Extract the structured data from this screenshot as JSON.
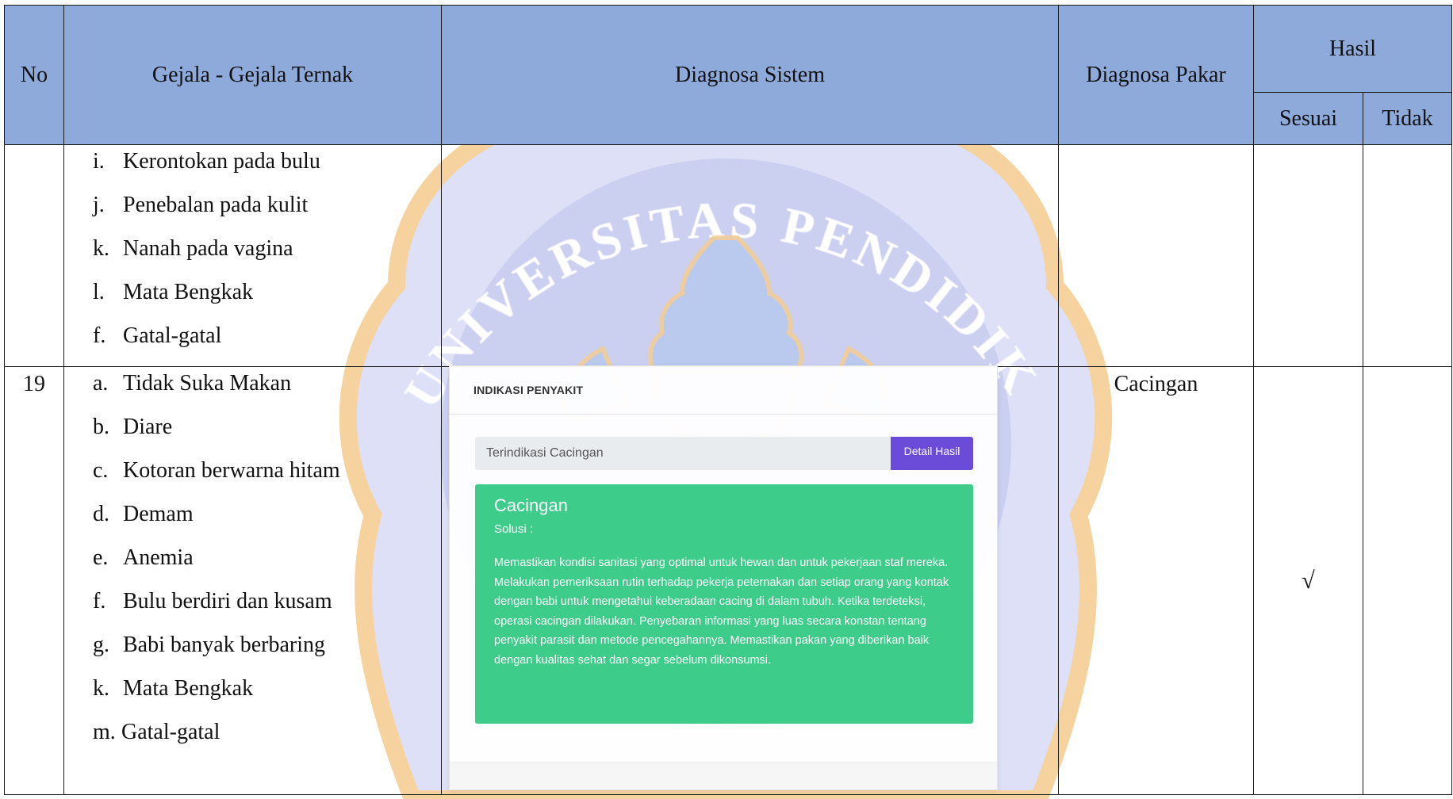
{
  "table": {
    "headers": {
      "no": "No",
      "gejala": "Gejala - Gejala Ternak",
      "diagnosa_sistem": "Diagnosa Sistem",
      "diagnosa_pakar": "Diagnosa Pakar",
      "hasil": "Hasil",
      "sesuai": "Sesuai",
      "tidak": "Tidak"
    },
    "row_continued": {
      "no": "",
      "symptoms": [
        {
          "letter": "i.",
          "text": "Kerontokan pada bulu"
        },
        {
          "letter": "j.",
          "text": "Penebalan pada kulit"
        },
        {
          "letter": "k.",
          "text": "Nanah pada vagina"
        },
        {
          "letter": "l.",
          "text": "Mata Bengkak"
        },
        {
          "letter": "f.",
          "text": "Gatal-gatal"
        }
      ]
    },
    "row_19": {
      "no": "19",
      "symptoms": [
        {
          "letter": "a.",
          "text": "Tidak Suka Makan"
        },
        {
          "letter": "b.",
          "text": "Diare"
        },
        {
          "letter": "c.",
          "text": "Kotoran berwarna hitam"
        },
        {
          "letter": "d.",
          "text": "Demam"
        },
        {
          "letter": "e.",
          "text": "Anemia"
        },
        {
          "letter": "f.",
          "text": "Bulu berdiri dan kusam"
        },
        {
          "letter": "g.",
          "text": "Babi banyak berbaring"
        },
        {
          "letter": "k.",
          "text": "Mata Bengkak"
        },
        {
          "letter": "m.",
          "text": "Gatal-gatal"
        }
      ],
      "diagnosa_pakar": "Cacingan",
      "sesuai_mark": "√",
      "tidak_mark": ""
    }
  },
  "app_card": {
    "header": "INDIKASI PENYAKIT",
    "result_value": "Terindikasi Cacingan",
    "detail_button": "Detail Hasil",
    "disease_title": "Cacingan",
    "solusi_label": "Solusi :",
    "solusi_text": "Memastikan kondisi sanitasi yang optimal untuk hewan dan untuk pekerjaan staf mereka. Melakukan pemeriksaan rutin terhadap pekerja peternakan dan setiap orang yang kontak dengan babi untuk mengetahui keberadaan cacing di dalam tubuh. Ketika terdeteksi, operasi cacingan dilakukan. Penyebaran informasi yang luas secara konstan tentang penyakit parasit dan metode pencegahannya. Memastikan pakan yang diberikan baik dengan kualitas sehat dan segar sebelum dikonsumsi."
  },
  "watermark": {
    "text": "UNIVERSITAS PENDIDIKAN GANESHA"
  },
  "colors": {
    "header_bg": "#8eaadb",
    "button_bg": "#6a4cd9",
    "alert_bg": "#3ecc8a",
    "watermark_blue": "#c9cdf0",
    "watermark_gold": "#f5cc8e"
  }
}
